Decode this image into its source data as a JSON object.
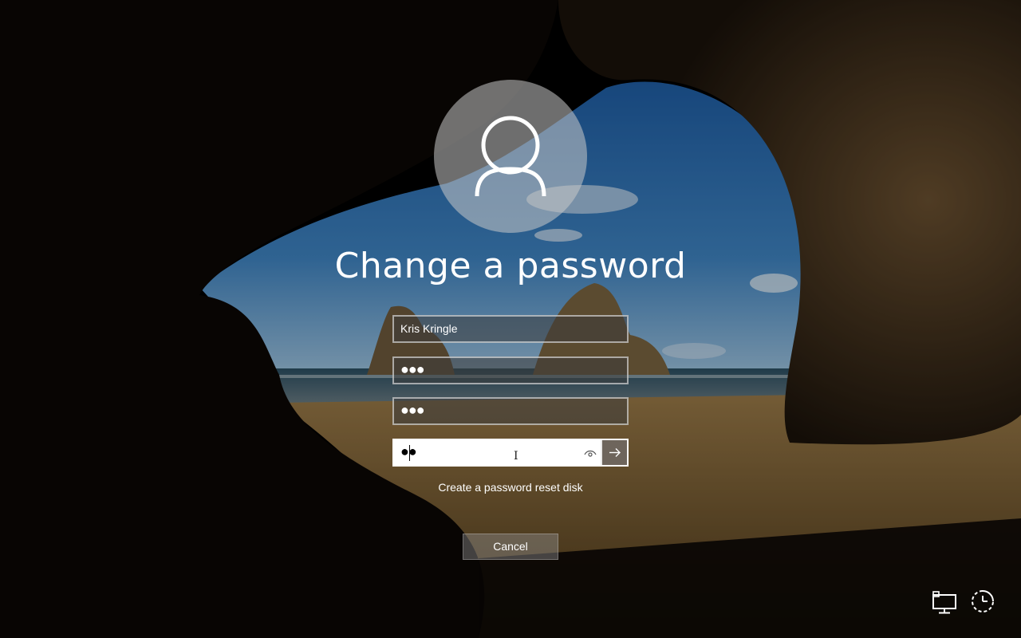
{
  "screen": {
    "title": "Change a password"
  },
  "form": {
    "username": "Kris Kringle",
    "old_password_mask": "●●●",
    "new_password_mask": "●●●",
    "confirm_password_mask": "●●",
    "reveal_icon": "eye-icon",
    "submit_icon": "arrow-right-icon"
  },
  "links": {
    "reset_disk": "Create a password reset disk"
  },
  "buttons": {
    "cancel": "Cancel"
  },
  "system_icons": {
    "network": "network-icon",
    "ease_of_access": "ease-of-access-icon"
  },
  "colors": {
    "sky": "#2f6fb0",
    "sand": "#8a6a3a",
    "rock": "#3a2a1a",
    "submit_bg": "#6e655c"
  }
}
